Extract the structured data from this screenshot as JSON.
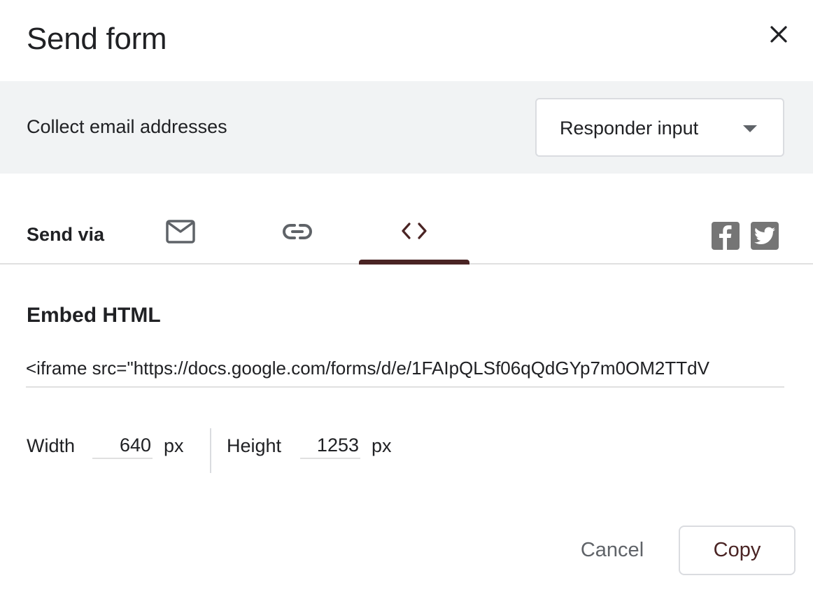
{
  "dialog": {
    "title": "Send form",
    "close_icon": "close-icon"
  },
  "collect_email": {
    "label": "Collect email addresses",
    "selected_option": "Responder input",
    "dropdown_icon": "arrow-drop-down-icon"
  },
  "send_via": {
    "label": "Send via",
    "tabs": [
      {
        "name": "email",
        "icon": "email-icon",
        "active": false
      },
      {
        "name": "link",
        "icon": "link-icon",
        "active": false
      },
      {
        "name": "embed",
        "icon": "code-icon",
        "active": true
      }
    ],
    "social": [
      {
        "name": "facebook",
        "icon": "facebook-icon"
      },
      {
        "name": "twitter",
        "icon": "twitter-icon"
      }
    ]
  },
  "embed": {
    "heading": "Embed HTML",
    "code": "<iframe src=\"https://docs.google.com/forms/d/e/1FAIpQLSf06qQdGYp7m0OM2TTdV",
    "width_label": "Width",
    "width_value": "640",
    "width_unit": "px",
    "height_label": "Height",
    "height_value": "1253",
    "height_unit": "px"
  },
  "actions": {
    "cancel_label": "Cancel",
    "copy_label": "Copy"
  },
  "colors": {
    "accent": "#4a2424",
    "icon_gray": "#5f6368",
    "panel_bg": "#f1f3f4",
    "divider": "#e0e0e0"
  }
}
